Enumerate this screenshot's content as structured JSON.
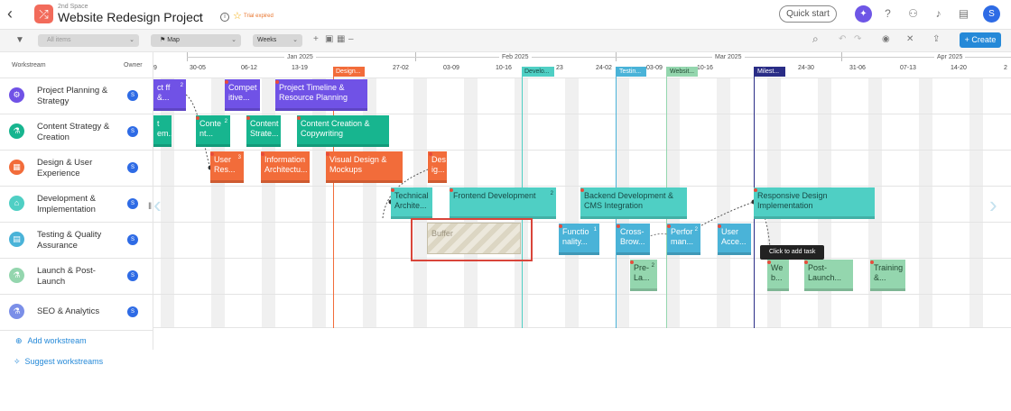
{
  "header": {
    "space": "2nd Space",
    "title": "Website Redesign Project",
    "trial": "Trial expired",
    "quick_start": "Quick start",
    "avatar": "S",
    "logo_icon": "shuffle-icon",
    "icons": [
      "sparkle-icon",
      "help-icon",
      "add-user-icon",
      "bell-icon",
      "chat-icon"
    ]
  },
  "toolbar": {
    "filter": "All items",
    "view": "Map",
    "scale": "Weeks",
    "create": "+ Create"
  },
  "sidebar": {
    "col_workstream": "Workstream",
    "col_owner": "Owner",
    "rows": [
      {
        "name": "Project Planning & Strategy",
        "color": "#7052e6",
        "owner": "S"
      },
      {
        "name": "Content Strategy & Creation",
        "color": "#17b58f",
        "owner": "S"
      },
      {
        "name": "Design & User Experience",
        "color": "#f26c3a",
        "owner": "S"
      },
      {
        "name": "Development & Implementation",
        "color": "#4fcfc4",
        "owner": "S"
      },
      {
        "name": "Testing & Quality Assurance",
        "color": "#4ab3d8",
        "owner": "S"
      },
      {
        "name": "Launch & Post-Launch",
        "color": "#94d6ae",
        "owner": "S"
      },
      {
        "name": "SEO & Analytics",
        "color": "#7b8fe8",
        "owner": "S"
      }
    ],
    "add_workstream": "Add workstream",
    "suggest_workstreams": "Suggest workstreams"
  },
  "timeline": {
    "months": [
      "Jan 2025",
      "Feb 2025",
      "Mar 2025",
      "Apr 2025"
    ],
    "weeks": [
      "9",
      "30-05",
      "06-12",
      "13-19",
      "27-02",
      "03-09",
      "10-16",
      "23",
      "24-02",
      "03-09",
      "10-16",
      "24-30",
      "31-06",
      "07-13",
      "14-20",
      "2"
    ],
    "milestones": [
      "Design...",
      "Develo...",
      "Testin...",
      "Websit...",
      "Milest..."
    ],
    "tasks": {
      "t1": {
        "label": "ct ff &...",
        "count": "2"
      },
      "t2": {
        "label": "Compet itive...",
        "count": ""
      },
      "t3": {
        "label": "Project Timeline & Resource Planning",
        "count": ""
      },
      "t4": {
        "label": "t em...",
        "count": ""
      },
      "t5": {
        "label": "Conte nt...",
        "count": "2"
      },
      "t6": {
        "label": "Content Strate...",
        "count": ""
      },
      "t7": {
        "label": "Content Creation & Copywriting",
        "count": ""
      },
      "t8": {
        "label": "User Res...",
        "count": "3"
      },
      "t9": {
        "label": "Information Architectu...",
        "count": ""
      },
      "t10": {
        "label": "Visual Design & Mockups",
        "count": ""
      },
      "t11": {
        "label": "Des ig...",
        "count": ""
      },
      "t12": {
        "label": "Technical Archite...",
        "count": ""
      },
      "t13": {
        "label": "Frontend Development",
        "count": "2"
      },
      "t14": {
        "label": "Backend Development & CMS Integration",
        "count": ""
      },
      "t15": {
        "label": "Responsive Design Implementation",
        "count": ""
      },
      "t16": {
        "label": "Functio nality...",
        "count": "1"
      },
      "t17": {
        "label": "Cross- Brow...",
        "count": ""
      },
      "t18": {
        "label": "Perfor man...",
        "count": "2"
      },
      "t19": {
        "label": "User Acce...",
        "count": ""
      },
      "t20": {
        "label": "Pre- La...",
        "count": "2"
      },
      "t21": {
        "label": "We b...",
        "count": ""
      },
      "t22": {
        "label": "Post- Launch...",
        "count": ""
      },
      "t23": {
        "label": "Training &...",
        "count": ""
      }
    },
    "buffer": "Buffer",
    "tooltip": "Click to add task"
  }
}
